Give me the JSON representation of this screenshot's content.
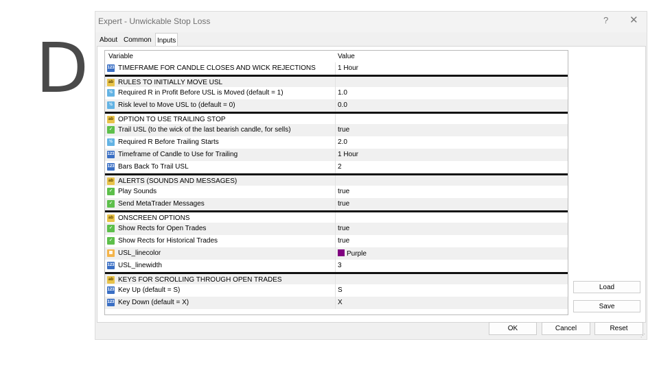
{
  "overlay_letter": "D",
  "window": {
    "title": "Expert - Unwickable Stop Loss",
    "help_label": "?",
    "close_label": "✕"
  },
  "tabs": [
    {
      "label": "About",
      "active": false
    },
    {
      "label": "Common",
      "active": false
    },
    {
      "label": "Inputs",
      "active": true
    }
  ],
  "table": {
    "columns": [
      "Variable",
      "Value"
    ],
    "rows": [
      {
        "type": "int",
        "icon": "integer-icon",
        "name": "TIMEFRAME FOR CANDLE CLOSES AND WICK REJECTIONS",
        "value": "1 Hour"
      },
      {
        "type": "str",
        "icon": "string-icon",
        "name": "RULES TO INITIALLY MOVE USL",
        "value": "",
        "sep": true
      },
      {
        "type": "dbl",
        "icon": "double-icon",
        "name": "Required R in Profit Before USL is Moved (default = 1)",
        "value": "1.0"
      },
      {
        "type": "dbl",
        "icon": "double-icon",
        "name": "Risk level to Move USL to (default = 0)",
        "value": "0.0"
      },
      {
        "type": "str",
        "icon": "string-icon",
        "name": "OPTION TO USE TRAILING STOP",
        "value": "",
        "sep": true
      },
      {
        "type": "bool",
        "icon": "boolean-icon",
        "name": "Trail USL (to the wick of the last bearish candle, for sells)",
        "value": "true"
      },
      {
        "type": "dbl",
        "icon": "double-icon",
        "name": "Required R Before Trailing Starts",
        "value": "2.0"
      },
      {
        "type": "int",
        "icon": "integer-icon",
        "name": "Timeframe of Candle to Use for Trailing",
        "value": "1 Hour"
      },
      {
        "type": "int",
        "icon": "integer-icon",
        "name": "Bars Back To Trail USL",
        "value": "2"
      },
      {
        "type": "str",
        "icon": "string-icon",
        "name": "ALERTS (SOUNDS AND MESSAGES)",
        "value": "",
        "sep": true
      },
      {
        "type": "bool",
        "icon": "boolean-icon",
        "name": "Play Sounds",
        "value": "true"
      },
      {
        "type": "bool",
        "icon": "boolean-icon",
        "name": "Send MetaTrader Messages",
        "value": "true"
      },
      {
        "type": "str",
        "icon": "string-icon",
        "name": "ONSCREEN OPTIONS",
        "value": "",
        "sep": true
      },
      {
        "type": "bool",
        "icon": "boolean-icon",
        "name": "Show Rects for Open Trades",
        "value": "true"
      },
      {
        "type": "bool",
        "icon": "boolean-icon",
        "name": "Show Rects for Historical Trades",
        "value": "true"
      },
      {
        "type": "col",
        "icon": "color-icon",
        "name": "USL_linecolor",
        "value": "Purple",
        "swatch": "#800080"
      },
      {
        "type": "int",
        "icon": "integer-icon",
        "name": "USL_linewidth",
        "value": "3"
      },
      {
        "type": "str",
        "icon": "string-icon",
        "name": "KEYS FOR SCROLLING THROUGH OPEN TRADES",
        "value": "",
        "sep": true
      },
      {
        "type": "int",
        "icon": "integer-icon",
        "name": "Key Up (default = S)",
        "value": "S"
      },
      {
        "type": "int",
        "icon": "integer-icon",
        "name": "Key Down (default = X)",
        "value": "X"
      }
    ]
  },
  "side_buttons": {
    "load": "Load",
    "save": "Save"
  },
  "footer": {
    "ok": "OK",
    "cancel": "Cancel",
    "reset": "Reset"
  }
}
